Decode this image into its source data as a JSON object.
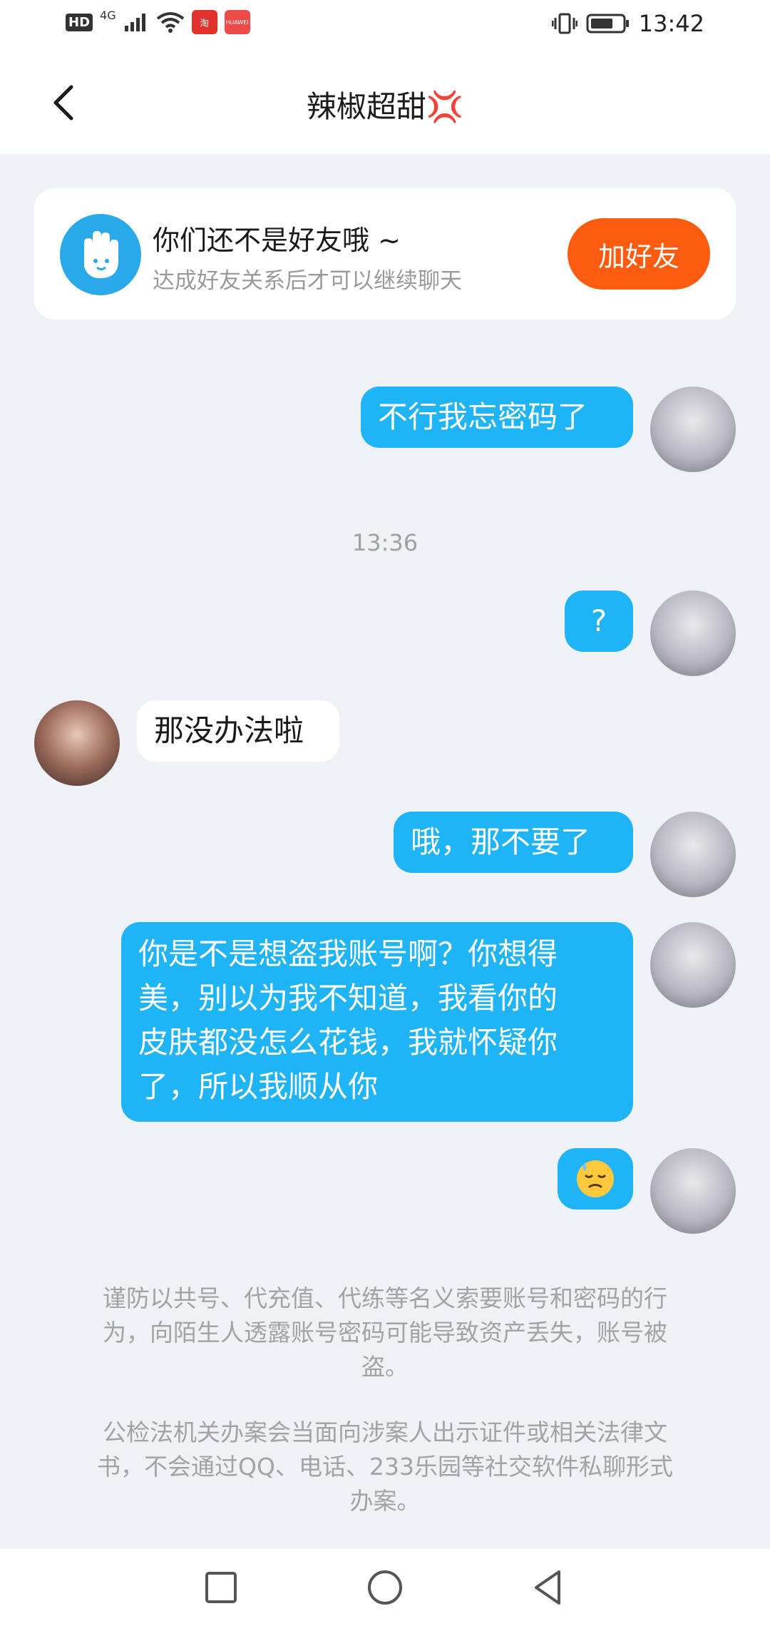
{
  "status_bar": {
    "hd": "HD",
    "network": "4G",
    "app_badge_1": "淘",
    "app_badge_2": "HUAWEI",
    "time": "13:42"
  },
  "header": {
    "title": "辣椒超甜",
    "title_emoji": "💢"
  },
  "friend_prompt": {
    "title": "你们还不是好友哦 ~",
    "subtitle": "达成好友关系后才可以继续聊天",
    "add_button": "加好友"
  },
  "messages": [
    {
      "side": "out",
      "text": "不行我忘密码了"
    },
    {
      "side": "out",
      "text": "?"
    },
    {
      "side": "in",
      "text": "那没办法啦"
    },
    {
      "side": "out",
      "text": "哦，那不要了"
    },
    {
      "side": "out",
      "lines": [
        "你是不是想盗我账号啊？你想得",
        "美，别以为我不知道，我看你的",
        "皮肤都没怎么花钱，我就怀疑你",
        "了，所以我顺从你"
      ]
    },
    {
      "side": "out",
      "emoji": "downcast-face-with-sweat"
    }
  ],
  "timestamp": "13:36",
  "notices": [
    {
      "lines": [
        "谨防以共号、代充值、代练等名义索要账号和密码的行",
        "为，向陌生人透露账号密码可能导致资产丢失，账号被",
        "盗。"
      ]
    },
    {
      "lines": [
        "公检法机关办案会当面向涉案人出示证件或相关法律文",
        "书，不会通过QQ、电话、233乐园等社交软件私聊形式",
        "办案。"
      ]
    }
  ],
  "colors": {
    "outgoing_bubble": "#1eb4f5",
    "add_button": "#fd5b0f",
    "background": "#eef1f6"
  }
}
